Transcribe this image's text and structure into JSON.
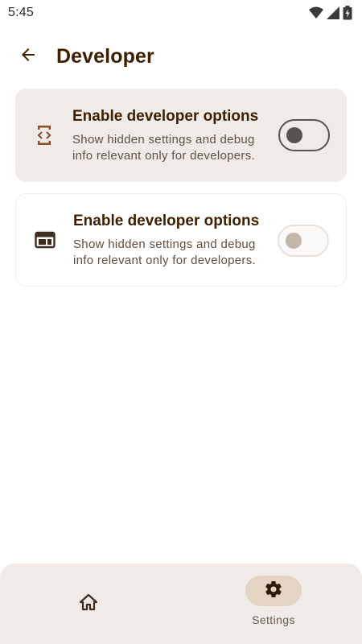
{
  "status_bar": {
    "time": "5:45",
    "icons": [
      "wifi-icon",
      "cellular-icon",
      "battery-icon"
    ]
  },
  "top_bar": {
    "back_icon": "arrow-back-icon",
    "title": "Developer"
  },
  "cards": [
    {
      "icon": "developer-mode-icon",
      "title": "Enable developer options",
      "subtitle": "Show hidden settings and debug info relevant only for developers.",
      "toggle_on": false,
      "enabled": true
    },
    {
      "icon": "web-window-icon",
      "title": "Enable developer options",
      "subtitle": "Show hidden settings and debug info relevant only for developers.",
      "toggle_on": false,
      "enabled": false
    }
  ],
  "bottom_nav": {
    "items": [
      {
        "icon": "home-icon",
        "label": "",
        "selected": false
      },
      {
        "icon": "settings-gear-icon",
        "label": "Settings",
        "selected": true
      }
    ]
  },
  "colors": {
    "primary_text": "#3e2000",
    "accent_icon": "#8d4f2e",
    "surface_container": "#f0ebe7",
    "nav_indicator": "#e3d4c4"
  }
}
